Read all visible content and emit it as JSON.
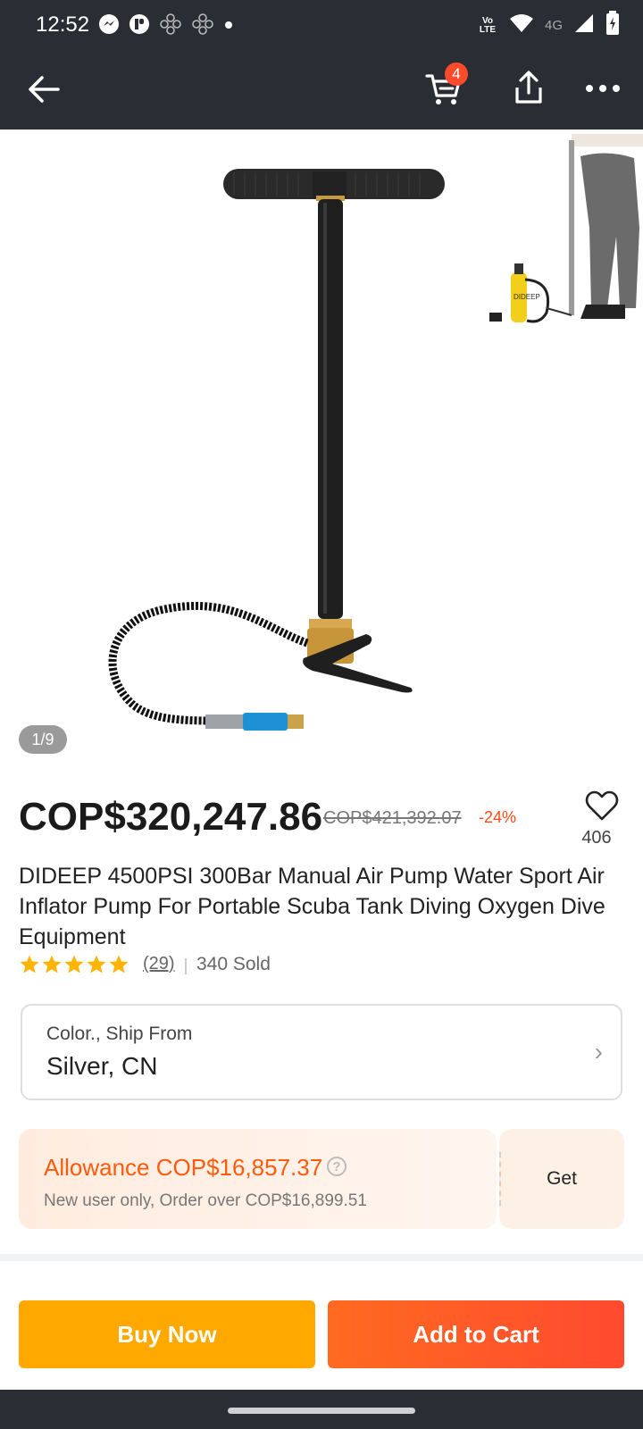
{
  "status_bar": {
    "time": "12:52",
    "left_icons": [
      "messenger-icon",
      "app-icon",
      "apps-icon",
      "apps-icon",
      "dot-icon"
    ],
    "right_icons": [
      "volte-icon",
      "wifi-icon",
      "4g-icon",
      "signal-icon",
      "battery-icon"
    ],
    "network": "4G",
    "volte_label": "Vo LTE"
  },
  "app_bar": {
    "back_icon": "arrow-left-icon",
    "cart_icon": "cart-icon",
    "cart_count": "4",
    "share_icon": "share-icon",
    "more_icon": "more-horizontal-icon"
  },
  "gallery": {
    "pager": "1/9",
    "thumbnail_label": "DIDEEP"
  },
  "product": {
    "price": "COP$320,247.86",
    "original_price": "COP$421,392.07",
    "discount": "-24%",
    "wishlist_count": "406",
    "title": "DIDEEP 4500PSI 300Bar Manual Air Pump Water Sport Air Inflator Pump For Portable Scuba Tank Diving Oxygen Dive Equipment",
    "rating": 5,
    "reviews": "(29)",
    "sold": "340 Sold"
  },
  "variant": {
    "label": "Color., Ship From",
    "value": "Silver, CN",
    "chevron": "›"
  },
  "coupon": {
    "title": "Allowance COP$16,857.37",
    "help": "?",
    "subtitle": "New user only, Order over COP$16,899.51",
    "action": "Get"
  },
  "bottom_actions": {
    "buy_now": "Buy Now",
    "add_to_cart": "Add to Cart"
  },
  "colors": {
    "dark_bar": "#2b2d34",
    "accent_orange": "#ff5b0a",
    "buy_now": "#ffa800",
    "add_to_cart": "#ff4a2f",
    "star": "#ffb400"
  }
}
